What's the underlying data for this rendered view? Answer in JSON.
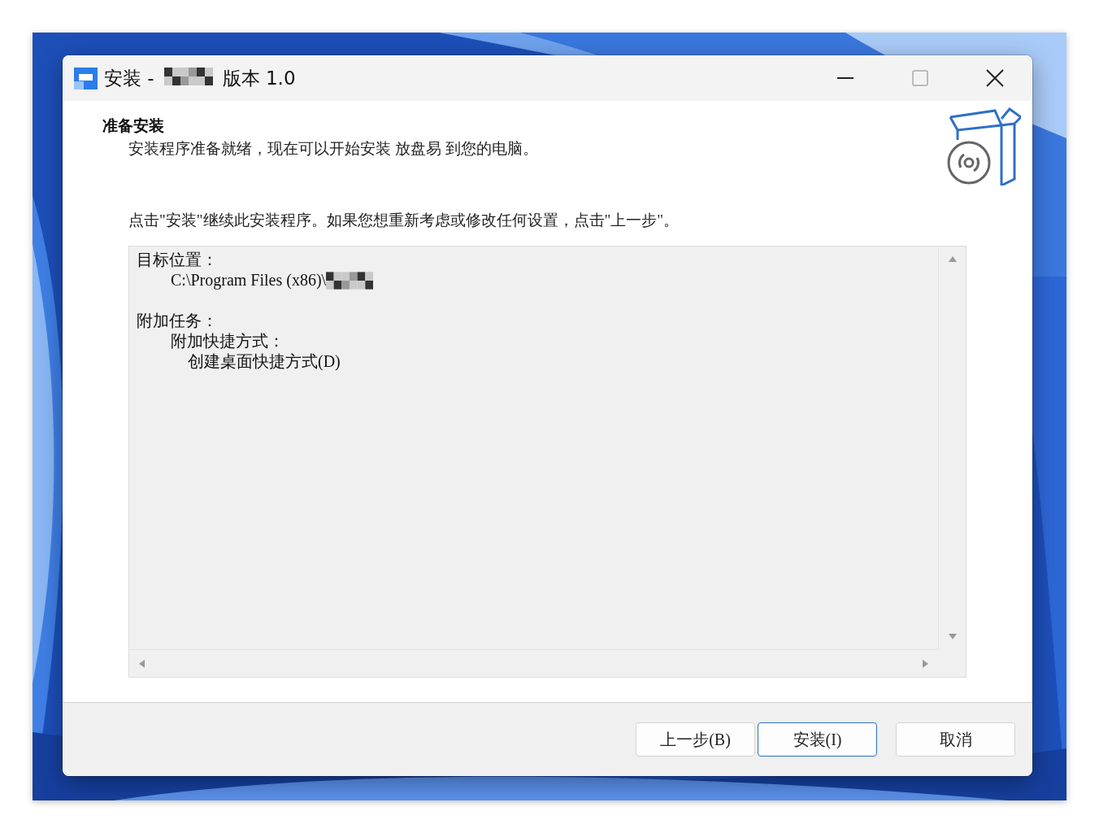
{
  "window": {
    "title_before": "安装 -",
    "title_redacted": true,
    "title_after": "版本 1.0"
  },
  "page": {
    "heading": "准备安装",
    "subtitle": "安装程序准备就绪，现在可以开始安装 放盘易 到您的电脑。",
    "instruction": "点击\"安装\"继续此安装程序。如果您想重新考虑或修改任何设置，点击\"上一步\"。"
  },
  "memo": [
    {
      "text": "目标位置：",
      "children": [
        {
          "text": "C:\\Program Files (x86)\\",
          "redacted": true
        }
      ]
    },
    {
      "text": "附加任务：",
      "children": [
        {
          "text": "附加快捷方式：",
          "children": [
            {
              "text": "创建桌面快捷方式(D)"
            }
          ]
        }
      ]
    }
  ],
  "buttons": [
    {
      "label": "上一步(B)",
      "default": false
    },
    {
      "label": "安装(I)",
      "default": true
    },
    {
      "label": "取消",
      "default": false
    }
  ]
}
